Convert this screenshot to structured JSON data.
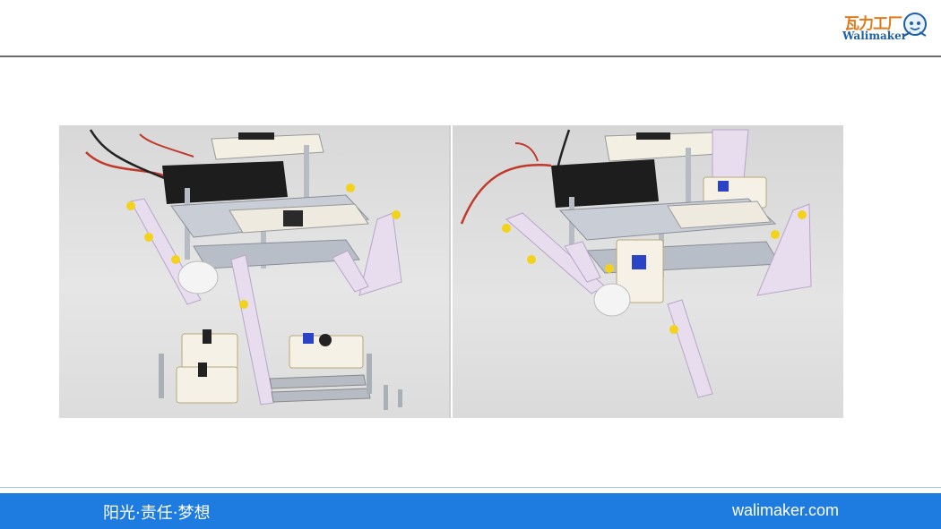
{
  "header": {
    "logo_cn": "瓦力工厂",
    "logo_en": "Walimaker"
  },
  "images": [
    {
      "name": "robot-with-parts-photo"
    },
    {
      "name": "robot-assembled-photo"
    }
  ],
  "footer": {
    "slogan": "阳光·责任·梦想",
    "site": "walimaker.com"
  },
  "colors": {
    "footer_bg": "#1e7be0",
    "rule": "#6b6b6b",
    "logo_orange": "#e07a1a",
    "logo_blue": "#1f5fa8"
  }
}
